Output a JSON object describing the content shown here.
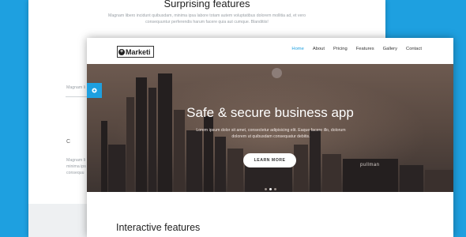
{
  "colors": {
    "accent": "#1ea0e0",
    "background": "#1ea0e0",
    "hero_dark": "#3d3431"
  },
  "back_page": {
    "title": "Surprising features",
    "subtitle": "Magnam libero incidunt quibusdam, minima ipsa labore totam autem voluptatibus dolorem mollitia ad, et vero consequuntur perferendis harum facere quia aut cumque. Blanditiis!",
    "fragments": {
      "left_1": "Magnam li",
      "left_2": "",
      "left_3": "C",
      "left_4": "Magnam li",
      "left_5": "minima ips",
      "left_6": "consequu"
    }
  },
  "front_page": {
    "logo": {
      "icon": "plus-circle-icon",
      "text": "Marketi"
    },
    "nav": [
      {
        "label": "Home",
        "active": true
      },
      {
        "label": "About",
        "active": false
      },
      {
        "label": "Pricing",
        "active": false
      },
      {
        "label": "Features",
        "active": false
      },
      {
        "label": "Gallery",
        "active": false
      },
      {
        "label": "Contact",
        "active": false
      }
    ],
    "hero": {
      "title": "Safe & secure business app",
      "subtitle": "Lorem ipsum dolor sit amet, consectetur adipisicing elit. Eaque facere illo, dolorum dolorem ut quibusdam consequatur debitis.",
      "button": "LEARN MORE",
      "sign": "pullman",
      "slider_dots": 3,
      "active_dot": 1
    },
    "settings_icon": "gear-icon",
    "section_title": "Interactive features"
  }
}
